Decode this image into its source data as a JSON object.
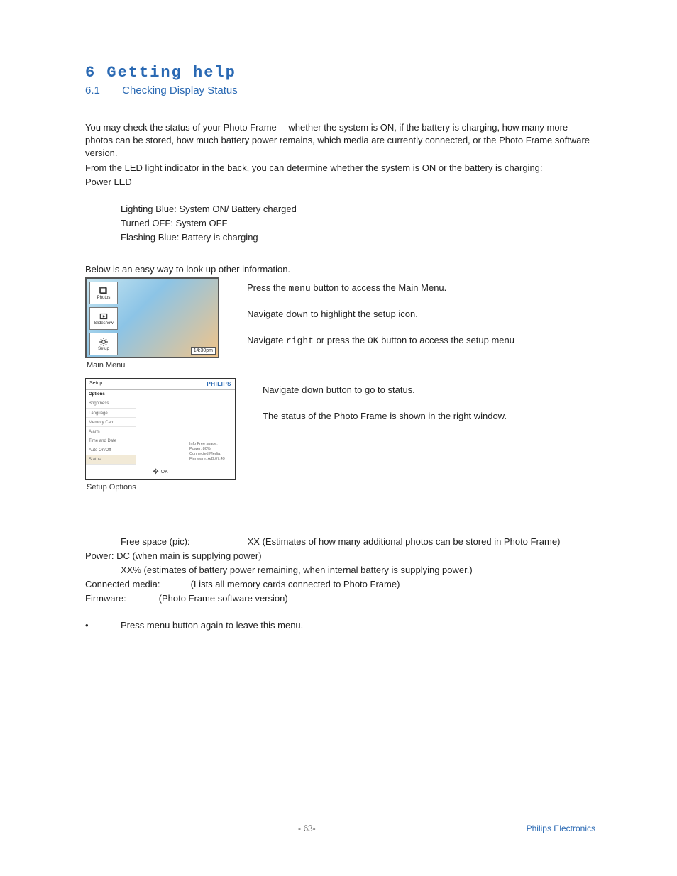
{
  "chapter_title": "6 Getting help",
  "section": {
    "num": "6.1",
    "title": "Checking Display Status"
  },
  "intro_p1": "You may check the status of your Photo Frame— whether the system is ON, if the battery is charging, how many more photos can be stored, how much battery power remains, which media are currently connected, or the Photo Frame software version.",
  "intro_p2": "From the LED light indicator in the back, you can determine whether the system is ON or the battery is charging:",
  "intro_p3": "Power LED",
  "led_lines": [
    "Lighting Blue: System ON/ Battery charged",
    "Turned OFF: System OFF",
    "Flashing Blue: Battery is charging"
  ],
  "below_line": "Below is an easy way to look up other information.",
  "step1": {
    "a": "Press the ",
    "key": "menu",
    "b": " button to access the Main Menu."
  },
  "step2": {
    "a": "Navigate ",
    "key": "down",
    "b": " to highlight the setup icon."
  },
  "step3": {
    "a": "Navigate ",
    "key1": "right",
    "mid": " or press the ",
    "key2": "OK",
    "b": " button to  access the setup menu"
  },
  "step4": {
    "a": "Navigate ",
    "key": "down",
    "b": " button to go to status."
  },
  "step5": "The status of the Photo Frame is shown in the right window.",
  "shot1": {
    "btn1": "Photos",
    "btn2": "Slideshow",
    "btn3": "Setup",
    "time": "14:30pm"
  },
  "caption1": "Main Menu",
  "shot2": {
    "title": "Setup",
    "brand": "PHILIPS",
    "options_label": "Options",
    "items": [
      "Brightness",
      "Language",
      "Memory Card",
      "Alarm",
      "Time and Date",
      "Auto On/Off",
      "Status"
    ],
    "info": [
      "Info Free space:",
      "Power: 80%",
      "Connected Media:",
      "Firmware: A/B.07.49"
    ],
    "ok": "OK"
  },
  "caption2": "Setup Options",
  "details": {
    "free_label": "Free space (pic):",
    "free_val": "XX (Estimates of how many additional photos can be stored in Photo Frame)",
    "power_line": "Power:  DC (when main is supplying power)",
    "power_indent": "XX% (estimates of battery power remaining, when internal battery is supplying power.)",
    "media_label": "Connected media:",
    "media_val": "(Lists all memory cards connected to Photo Frame)",
    "fw_label": "Firmware:",
    "fw_val": "(Photo Frame software version)"
  },
  "final_bullet": "Press   menu button again to leave this menu.",
  "footer": {
    "page": "- 63-",
    "brand": "Philips Electronics"
  }
}
